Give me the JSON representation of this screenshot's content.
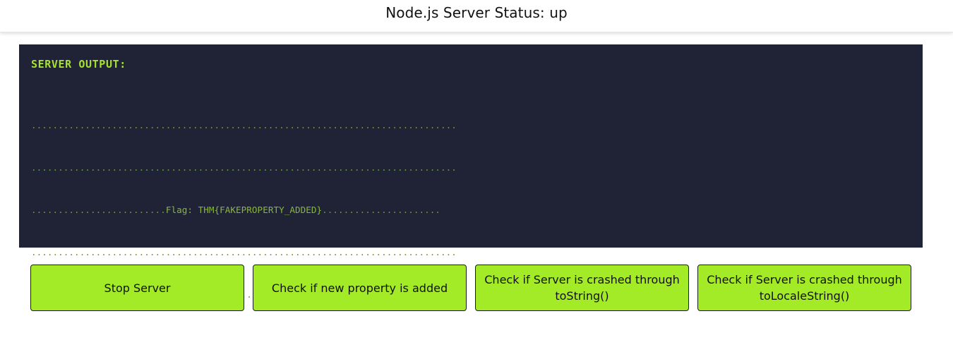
{
  "header": {
    "title": "Node.js Server Status: up"
  },
  "terminal": {
    "heading": "SERVER OUTPUT:",
    "lines": [
      "...............................................................................",
      "...............................................................................",
      {
        "prefix": ".........................",
        "flag": "Flag: THM{FAKEPROPERTY_ADDED}",
        "suffix": "......................"
      },
      "...............................................................................",
      "..............................................................................."
    ]
  },
  "buttons": {
    "stop": "Stop Server",
    "check_property": "Check if new property is added",
    "check_tostring": "Check if Server is crashed through toString()",
    "check_tolocalestring": "Check if Server is crashed through toLocaleString()"
  },
  "colors": {
    "terminal_bg": "#1f2335",
    "accent_green": "#a4eb27",
    "terminal_text": "#6c9e26"
  }
}
